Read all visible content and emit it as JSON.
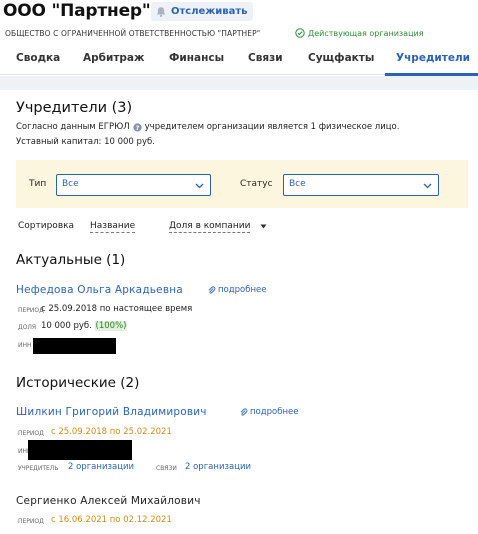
{
  "header": {
    "company_title": "ООО \"Партнер\"",
    "follow_label": "Отслеживать",
    "full_name": "ОБЩЕСТВО С ОГРАНИЧЕННОЙ ОТВЕТСТВЕННОСТЬЮ \"ПАРТНЕР\"",
    "status": "Действующая организация"
  },
  "tabs": [
    {
      "label": "Сводка",
      "active": false
    },
    {
      "label": "Арбитраж",
      "active": false
    },
    {
      "label": "Финансы",
      "active": false
    },
    {
      "label": "Связи",
      "active": false
    },
    {
      "label": "Сущфакты",
      "active": false
    },
    {
      "label": "Учредители",
      "active": true
    }
  ],
  "founders": {
    "title": "Учредители (3)",
    "egrul_prefix": "Согласно данным ЕГРЮЛ",
    "egrul_suffix": "учредителем организации является 1 физическое лицо.",
    "capital": "Уставный капитал: 10 000 руб."
  },
  "filters": {
    "type_label": "Тип",
    "type_value": "Все",
    "status_label": "Статус",
    "status_value": "Все"
  },
  "sort": {
    "label": "Сортировка",
    "option_name": "Название",
    "option_share": "Доля в компании"
  },
  "current": {
    "title": "Актуальные (1)",
    "person": {
      "name": "Нефедова Ольга Аркадьевна",
      "more": "подробнее",
      "period_label": "период",
      "period_value": "с 25.09.2018 по настоящее время",
      "share_label": "доля",
      "share_value": "10 000 руб.",
      "share_pct": "(100%)",
      "inn_label": "инн"
    }
  },
  "historical": {
    "title": "Исторические (2)",
    "persons": [
      {
        "name": "Шилкин Григорий Владимирович",
        "more": "подробнее",
        "period_label": "период",
        "period_value": "с 25.09.2018 по 25.02.2021",
        "inn_label": "инн",
        "founder_label": "учредитель",
        "founder_value": "2 организации",
        "links_label": "связи",
        "links_value": "2 организации"
      },
      {
        "name": "Сергиенко Алексей Михайлович",
        "period_label": "период",
        "period_value": "с 16.06.2021 по 02.12.2021"
      }
    ]
  },
  "icons": {
    "follow": "bell-icon",
    "status": "check-circle-icon",
    "egrul": "question-circle-icon",
    "select": "chevron-down-icon",
    "sort": "caret-down-icon",
    "more": "paperclip-icon"
  },
  "colors": {
    "link": "#2b63b4",
    "status_green": "#2e8b3a",
    "historical_period": "#d08a18",
    "filter_bg": "#fdf6df",
    "share_badge_bg": "#dff2d8"
  }
}
